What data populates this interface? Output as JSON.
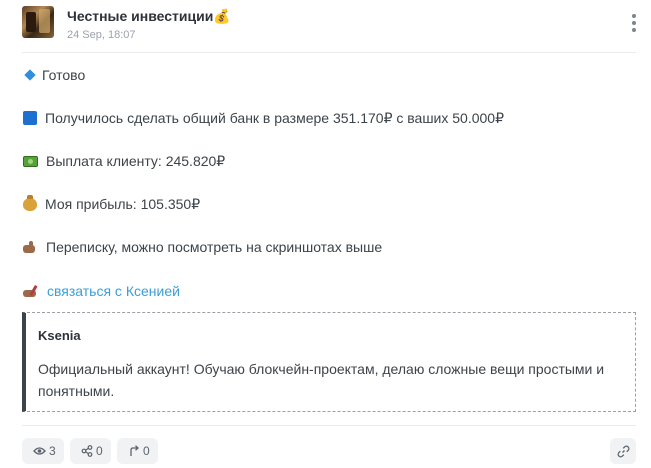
{
  "header": {
    "channel_name": "Честные инвестиции💰",
    "date": "24 Sep, 18:07",
    "menu_icon": "more-vertical-icon"
  },
  "post": {
    "lines": [
      {
        "icon": "blue-diamond-icon",
        "text": "Готово"
      },
      {
        "icon": "blue-square-icon",
        "text": "Получилось сделать общий банк в размере 351.170₽ с ваших 50.000₽"
      },
      {
        "icon": "cash-icon",
        "text": "Выплата клиенту: 245.820₽"
      },
      {
        "icon": "money-bag-icon",
        "text": "Моя прибыль: 105.350₽"
      },
      {
        "icon": "pointing-hand-icon",
        "text": "Переписку, можно посмотреть на скриншотах выше"
      },
      {
        "icon": "writing-hand-icon",
        "text": "связаться с Ксенией"
      }
    ],
    "link_color": "#3a9fd6"
  },
  "quote": {
    "title": "Ksenia",
    "text": "Официальный аккаунт! Обучаю блокчейн-проектам, делаю сложные вещи простыми и понятными."
  },
  "footer": {
    "views": "3",
    "shares": "0",
    "forwards": "0",
    "link_icon": "link-icon"
  }
}
